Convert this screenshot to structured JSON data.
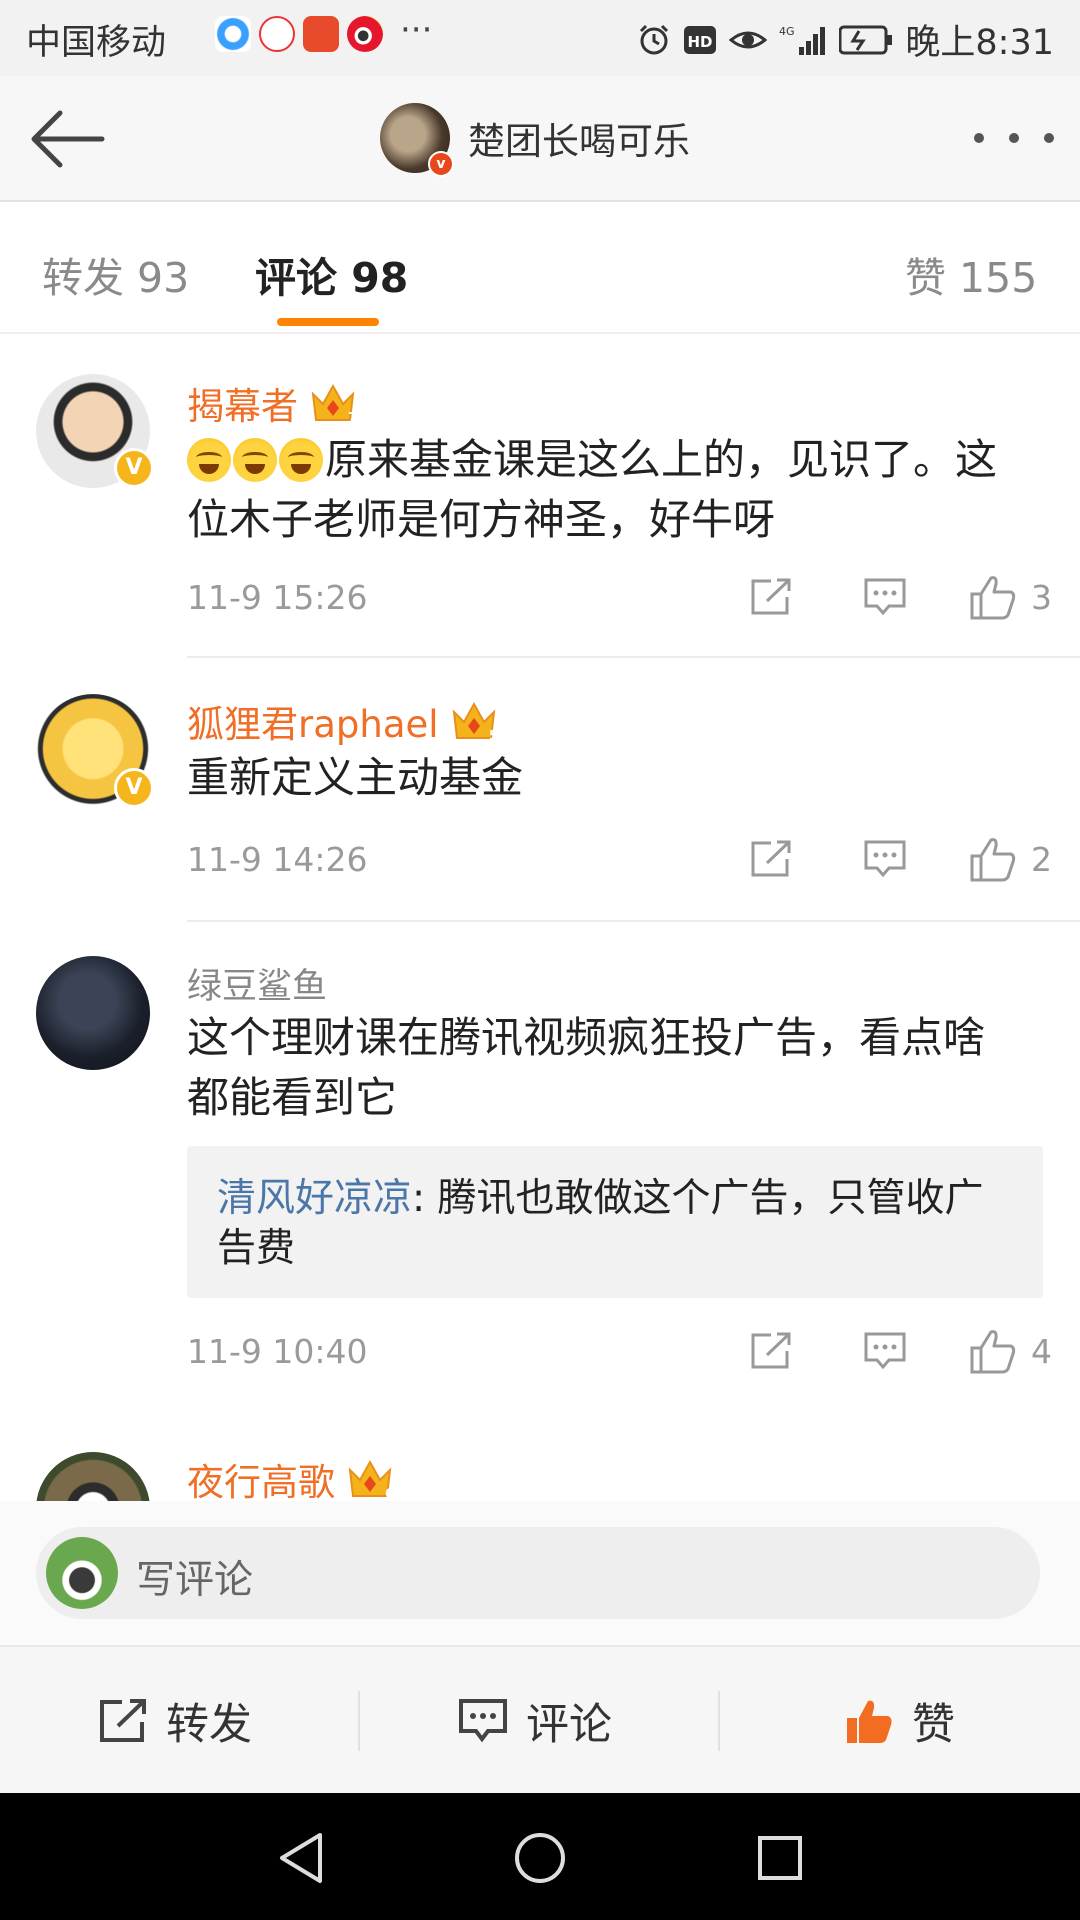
{
  "status_bar": {
    "carrier": "中国移动",
    "time": "晚上8:31",
    "more": "···",
    "icons": [
      "alarm-icon",
      "hd-icon",
      "eye-icon",
      "signal-4g-icon",
      "battery-charging-icon"
    ]
  },
  "header": {
    "title": "楚团长喝可乐",
    "verified_badge": "v"
  },
  "tabs": [
    {
      "label": "转发 93"
    },
    {
      "label": "评论 98"
    },
    {
      "label": "赞 155"
    }
  ],
  "accent_color": "#ff8200",
  "comments": [
    {
      "name": "揭幕者",
      "vip_level": "7",
      "verified": "V",
      "text": "原来基金课是这么上的，见识了。这位木子老师是何方神圣，好牛呀",
      "emoji_count": 3,
      "time": "11-9 15:26",
      "likes": "3"
    },
    {
      "name": "狐狸君raphael",
      "vip_level": "5",
      "verified": "V",
      "text": "重新定义主动基金",
      "time": "11-9 14:26",
      "likes": "2"
    },
    {
      "name": "绿豆鲨鱼",
      "text": "这个理财课在腾讯视频疯狂投广告，看点啥都能看到它",
      "reply": {
        "user": "清风好凉凉",
        "text": ": 腾讯也敢做这个广告，只管收广告费"
      },
      "time": "11-9 10:40",
      "likes": "4"
    },
    {
      "name": "夜行高歌",
      "vip_level": "6"
    }
  ],
  "comment_input": {
    "placeholder": "写评论"
  },
  "action_bar": {
    "repost": "转发",
    "comment": "评论",
    "like": "赞"
  }
}
